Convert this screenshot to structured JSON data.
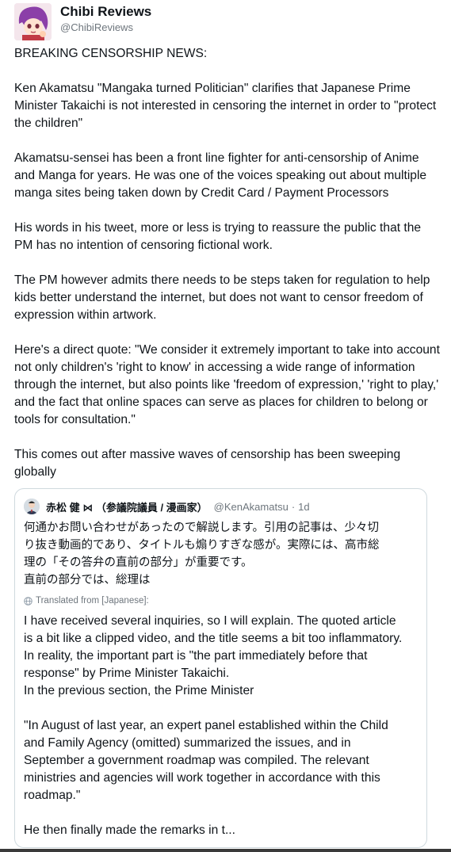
{
  "author": {
    "name": "Chibi Reviews",
    "handle": "@ChibiReviews"
  },
  "post": {
    "paragraphs": [
      "BREAKING CENSORSHIP NEWS:",
      "Ken Akamatsu \"Mangaka turned Politician\" clarifies that Japanese Prime Minister Takaichi is not interested in censoring the internet in order to \"protect the children\"",
      "Akamatsu-sensei has been a front line fighter for anti-censorship of Anime and Manga for years. He was one of the voices speaking out about multiple manga sites being taken down by Credit Card / Payment Processors",
      "His words in his tweet, more or less is trying to reassure the public that the PM has no intention of censoring fictional work.",
      "The PM however admits there needs to be steps taken for regulation to help kids better understand the internet, but does not want to censor freedom of expression within artwork.",
      "Here's a direct quote: \"We consider it extremely important to take into account not only children's 'right to know' in accessing a wide range of information through the internet, but also points like 'freedom of expression,' 'right to play,' and the fact that online spaces can serve as places for children to belong or tools for consultation.\"",
      "This comes out after massive waves of censorship has been sweeping globally"
    ]
  },
  "quoted": {
    "name": "赤松 健 ⋈ （参議院議員 / 漫画家）",
    "handle": "@KenAkamatsu",
    "separator": "·",
    "time": "1d",
    "japanese_lines": [
      "何通かお問い合わせがあったので解説します。引用の記事は、少々切",
      "り抜き動画的であり、タイトルも煽りすぎな感が。実際には、高市総",
      "理の「その答弁の直前の部分」が重要です。",
      "直前の部分では、総理は"
    ],
    "translated_label": "Translated from [Japanese]:",
    "english_lines": [
      "I have received several inquiries, so I will explain. The quoted article",
      "is a bit like a clipped video, and the title seems a bit too inflammatory.",
      "In reality, the important part is \"the part immediately before that",
      "response\" by Prime Minister Takaichi.",
      "In the previous section, the Prime Minister",
      "",
      "\"In August of last year, an expert panel established within the Child",
      "and Family Agency (omitted) summarized the issues, and in",
      "September a government roadmap was compiled. The relevant",
      "ministries and agencies will work together in accordance with this",
      "roadmap.\"",
      "",
      "He then finally made the remarks in t..."
    ]
  }
}
